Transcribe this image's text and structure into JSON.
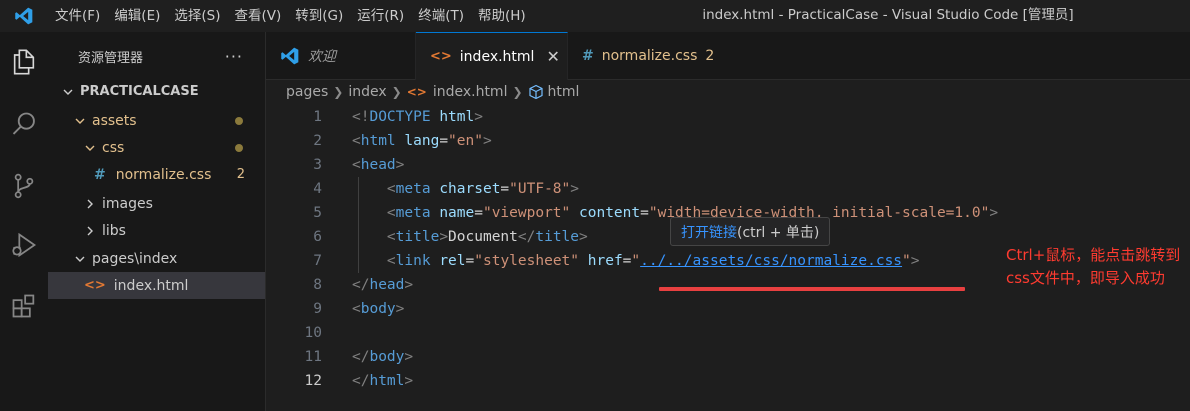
{
  "window": {
    "title": "index.html - PracticalCase - Visual Studio Code [管理员]"
  },
  "menu": [
    "文件(F)",
    "编辑(E)",
    "选择(S)",
    "查看(V)",
    "转到(G)",
    "运行(R)",
    "终端(T)",
    "帮助(H)"
  ],
  "activity_bar": [
    "files-icon",
    "search-icon",
    "source-control-icon",
    "run-debug-icon",
    "extensions-icon"
  ],
  "sidebar": {
    "title": "资源管理器",
    "more": "···",
    "tree": [
      {
        "label": "PRACTICALCASE",
        "level": 0,
        "chevron": "down"
      },
      {
        "label": "assets",
        "level": 1,
        "chevron": "down",
        "modified_dot": true
      },
      {
        "label": "css",
        "level": 2,
        "chevron": "down",
        "modified_dot": true
      },
      {
        "label": "normalize.css",
        "level": 3,
        "icon": "#",
        "badge": "2"
      },
      {
        "label": "images",
        "level": 2,
        "chevron": "right"
      },
      {
        "label": "libs",
        "level": 2,
        "chevron": "right"
      },
      {
        "label": "pages\\index",
        "level": 1,
        "chevron": "down"
      },
      {
        "label": "index.html",
        "level": 2,
        "icon": "<>",
        "selected": true
      }
    ]
  },
  "tabs": [
    {
      "label": "欢迎",
      "icon": "vscode-icon"
    },
    {
      "label": "index.html",
      "icon": "html-icon",
      "active": true,
      "close": "✕"
    },
    {
      "label": "normalize.css",
      "icon": "#",
      "badge": "2"
    }
  ],
  "breadcrumb": [
    "pages",
    "index",
    "index.html",
    "html"
  ],
  "code": {
    "line_numbers": [
      "1",
      "2",
      "3",
      "4",
      "5",
      "6",
      "7",
      "8",
      "9",
      "10",
      "11",
      "12"
    ],
    "current_line": "12"
  },
  "hover": {
    "link_text": "打开链接",
    "hint": " (ctrl + 单击)"
  },
  "annotation": {
    "text": "Ctrl+鼠标，能点击跳转到css文件中，即导入成功",
    "color": "#ff3b30"
  },
  "colors": {
    "accent": "#0078d4",
    "link": "#3794ff",
    "modified": "#e2c08d"
  }
}
